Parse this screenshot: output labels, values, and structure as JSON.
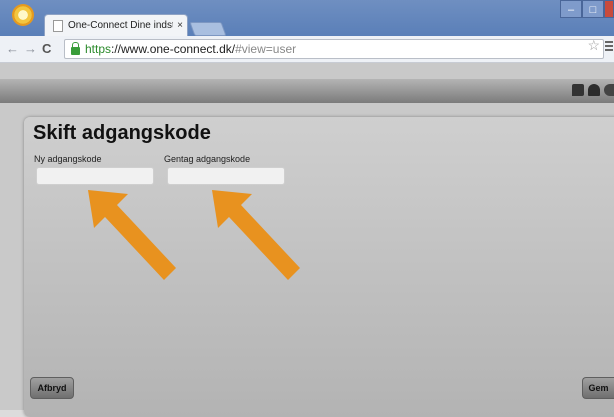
{
  "browser": {
    "tab_title": "One-Connect Dine indstill",
    "tab_close": "×",
    "url_secure": "https",
    "url_rest": "://www.one-connect.dk/",
    "url_hash": "#view=user",
    "window_controls": [
      "–",
      "□",
      "×"
    ]
  },
  "dialog": {
    "title": "Skift adgangskode",
    "fields": [
      {
        "label": "Ny adgangskode",
        "value": ""
      },
      {
        "label": "Gentag adgangskode",
        "value": ""
      }
    ],
    "cancel_label": "Afbryd",
    "save_label": "Gem"
  },
  "colors": {
    "arrow": "#e8921f",
    "header_gradient_top": "#b4b4b4",
    "header_gradient_bottom": "#7b7b7b"
  }
}
